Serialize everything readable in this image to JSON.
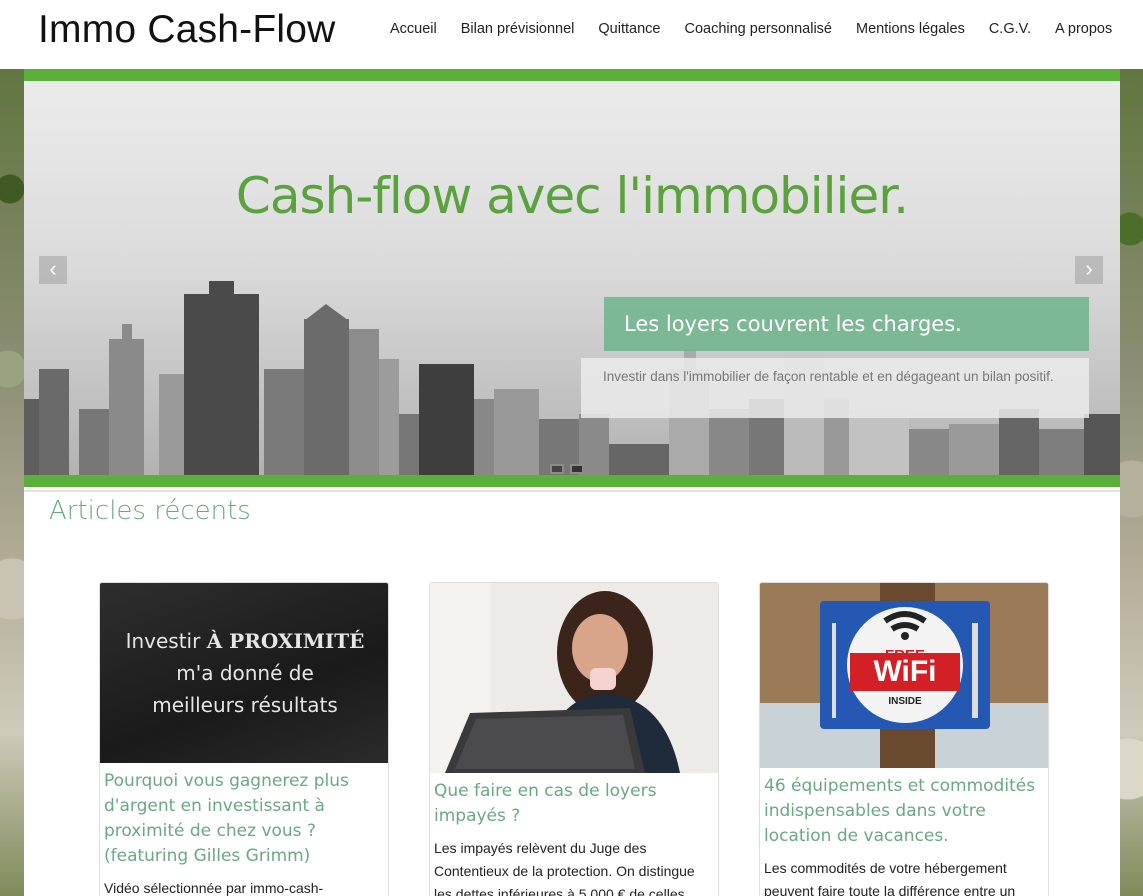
{
  "site": {
    "brand": "Immo Cash-Flow",
    "nav": [
      "Accueil",
      "Bilan prévisionnel",
      "Quittance",
      "Coaching personnalisé",
      "Mentions légales",
      "C.G.V.",
      "A propos"
    ]
  },
  "hero": {
    "title": "Cash-flow avec l'immobilier.",
    "caption_title": "Les loyers couvrent les charges.",
    "caption_text": "Investir dans l'immobilier de façon rentable et en dégageant un bilan positif.",
    "prev_icon": "chevron-left-icon",
    "next_icon": "chevron-right-icon",
    "slide_count": 2,
    "colors": {
      "accent_green": "#5aa23d",
      "caption_bg": "#6db38c"
    }
  },
  "articles": {
    "heading": "Articles récents",
    "items": [
      {
        "image_text_line1": "Investir",
        "image_text_bold": "À PROXIMITÉ",
        "image_text_line2": "m'a donné de",
        "image_text_line3": "meilleurs résultats",
        "title": "Pourquoi vous gagnerez plus d'argent en investissant à proximité de chez vous ? (featuring Gilles Grimm)",
        "excerpt": "Vidéo sélectionnée par immo-cash-"
      },
      {
        "image": "woman-with-laptop-photo",
        "title": "Que faire en cas de loyers impayés ?",
        "excerpt": "Les impayés relèvent du Juge des Contentieux de la protection. On distingue les dettes inférieures à 5 000 € de celles"
      },
      {
        "image_sign_top": "FREE",
        "image_sign_main": "WiFi",
        "image_sign_bottom": "INSIDE",
        "title": "46 équipements et commodités indispensables dans votre location de vacances.",
        "excerpt": "Les commodités de votre hébergement peuvent faire toute la différence entre un"
      }
    ]
  }
}
